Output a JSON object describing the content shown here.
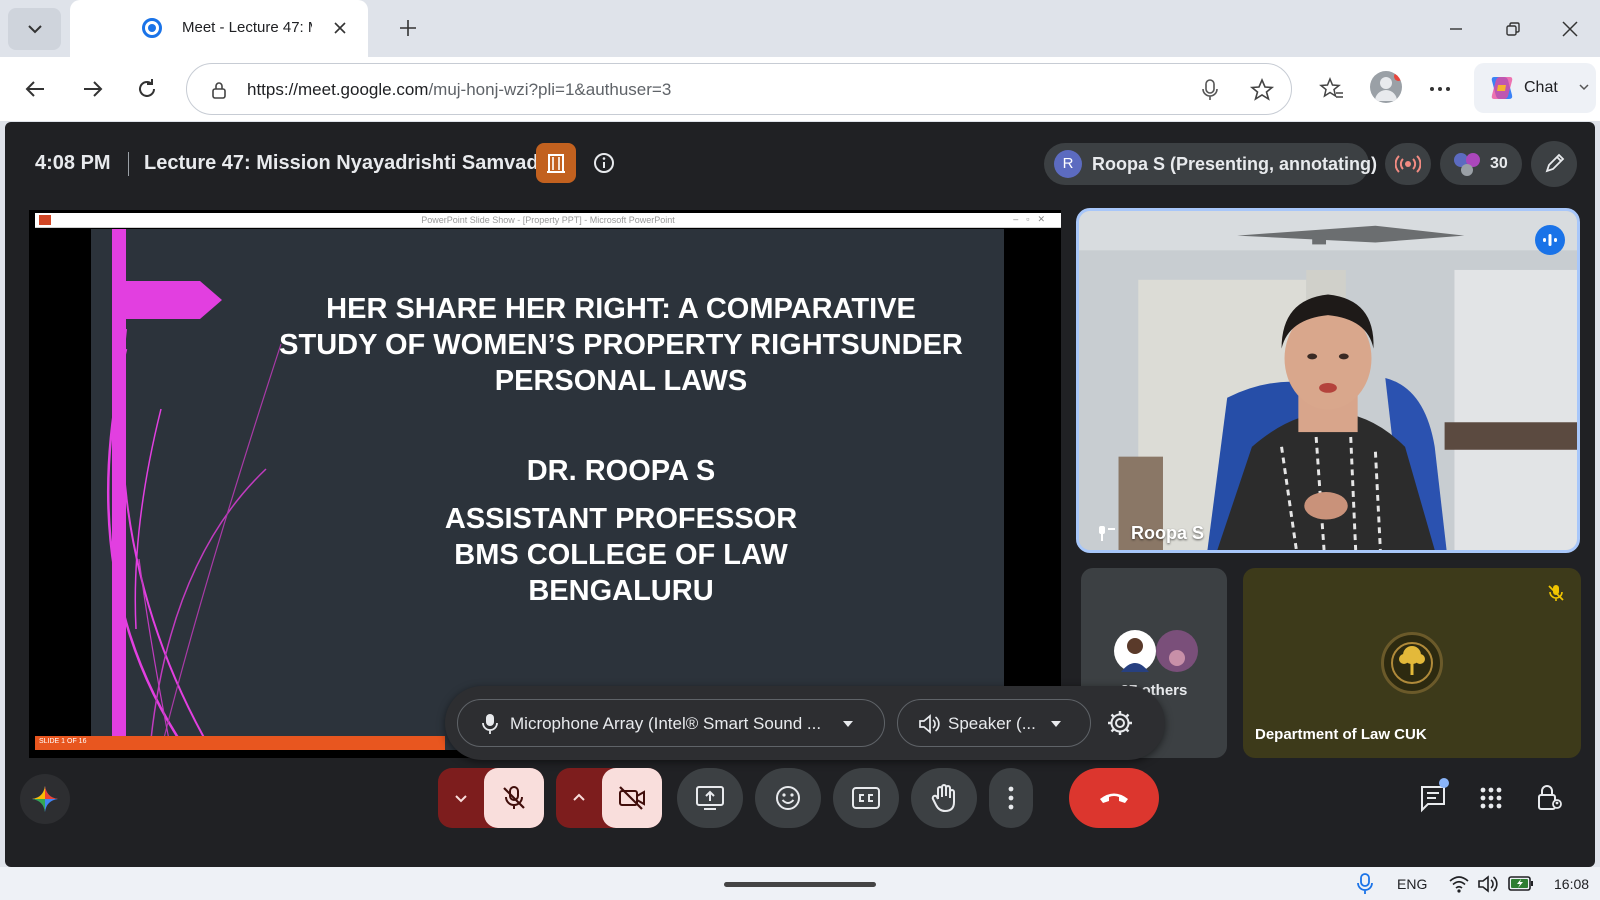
{
  "browser": {
    "tab": {
      "title": "Meet - Lecture 47: M"
    },
    "url": {
      "host": "https://meet.google.com",
      "path": "/muj-honj-wzi?pli=1&authuser=3"
    },
    "chat_label": "Chat"
  },
  "meet": {
    "clock": "4:08 PM",
    "title": "Lecture 47: Mission Nyayadrishti Samvad",
    "presenter_chip": {
      "initial": "R",
      "label": "Roopa S (Presenting, annotating)"
    },
    "people_count": "30"
  },
  "slide": {
    "title_lines": [
      "HER SHARE HER RIGHT: A COMPARATIVE",
      "STUDY OF WOMEN’S PROPERTY RIGHTSUNDER",
      "PERSONAL LAWS"
    ],
    "author": "DR. ROOPA S",
    "affiliation": [
      "ASSISTANT PROFESSOR",
      "BMS COLLEGE OF LAW",
      "BENGALURU"
    ],
    "window_title": "PowerPoint Slide Show - [Property PPT] - Microsoft PowerPoint",
    "slide_number": "SLIDE 1 OF 16"
  },
  "tiles": {
    "speaker_name": "Roopa S",
    "others_label": "27 others",
    "dept_name": "Department of Law CUK"
  },
  "devices": {
    "microphone": "Microphone Array (Intel® Smart Sound ...",
    "speaker": "Speaker (..."
  },
  "taskbar": {
    "lang": "ENG",
    "time": "16:08"
  },
  "colors": {
    "meet_bg": "#202124",
    "slide_bg": "#2c333b",
    "slide_accent": "#e23fe0",
    "end_call": "#dc362e",
    "muted_red": "#7d1d1d",
    "speaking_border": "#a8c7fa"
  }
}
